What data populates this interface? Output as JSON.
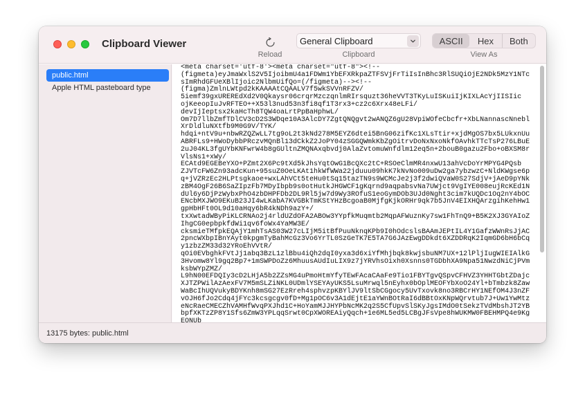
{
  "window": {
    "title": "Clipboard Viewer"
  },
  "toolbar": {
    "reload_label": "Reload",
    "clipboard_selected": "General Clipboard",
    "clipboard_label": "Clipboard",
    "view_options": [
      "ASCII",
      "Hex",
      "Both"
    ],
    "view_selected": "ASCII",
    "view_label": "View As"
  },
  "sidebar": {
    "items": [
      {
        "label": "public.html",
        "selected": true
      },
      {
        "label": "Apple HTML pasteboard type",
        "selected": false
      }
    ]
  },
  "content": {
    "lines": [
      "<meta charset='utf-8'><meta charset=\"utf-8\"><!--",
      "(figmeta)eyJmaWxlS2V5IjoibmU4a1FDWm1YbEFXRkpaZTFSVjFrTiIsInBhc3RlSUQiOjE2NDk5MzY1NTc",
      "sImRhdGFUeXBlIjoic2NlbmUifQo=(/figmeta)--><!--",
      "(figma)ZmlnLWtpd2kKAAAAtCQAALV7f5wkSVVnRFZV/",
      "5iemf39gxUREREdXd2V0Qkaysr06crqrMzczqnlmRIrsquzt36heVVT3TKyLuISKuiIjKIXLAcYjIISIic",
      "ojKeeopIuJvRFTEO++X53l3nud53n3fi8qf1T3rx3+cz2c6Xrx48eLFi/",
      "devIjIeptsx2kaHcTh8TQW4oaLrtPpBaHphwL/",
      "Om7D7llbZmfTDlCV3cD2S3WDqe10A3AlcDY7ZgtQNQgvt2wANQZ6gU28VpiWOfeCbcfr+XbLNannascNnebl",
      "XrDldluNXtfb9M0G9V/TYK/",
      "hdqi+ntV9u+nbwRZQZwLL7tg9oL2t3kNd278M5EYZ6dtei5BnG06zifKc1XLsTtir+xjdMgOS7bx5LUkxnUu",
      "ABRFLs9+HWoDybbPRczvMQnBl13dCkkZ2JoPY04zSGGQWmkKbZgOitrvDoNxNxoNkfOAvhkTTcTsP276LBuE",
      "2uJ04KL3fgUYbKNFwrW4b8gGUltnZMQNAxqbvdj0AlaZvtomuWnfdlm12eq5n+2bouB0gazu2Fbo+oBXSM8r",
      "VlsNs1+xWy/",
      "ECAtd9EGEBeYXO+PZmt2X6Pc9tXd5kJhsYqtOwG1BcQXc2tC+RSOeClmMR4nxwU13ahVcDoYrMPYG4PQsb",
      "ZJVTcFW6Zn93adcKun+95suZ0OeLKAt1hkWfWWa22jduuu09hkK7kNvNo009uDw2ga7ybzwzC+NldKWgse6p",
      "q+jVZRzEc2HLPtsgkaoe+wxLAhVCt5teHu0tSq15tazTN9s9WCMcJe2j3f2dwiQVaW0S27SdjV+jAeD9pYNk",
      "zBM4OgF26B6SaZIpzFb7MDyIbpb9s0otHutkJHGWCF1gKqrnd9aqpabsvNa7UWjct9VgIYE008eujRcKEd1N",
      "dUl6y6DjPzWybxPhO4zbDHPFDb2DL9Rl5jw7d9Wy3ROfuS1eoGymDOb3UJd0Nght3cim7kUQDc1Oq2nY4bOC",
      "ENcbMXJWO9EKuB23JI4wLKabA7KVGBkTmKStYHzBcgoaB0MjfgKjkORHr9qk7b5JnV4EIXHQArzgihKehHw1",
      "gpHbHFt0OL9d10aHqy6bR4kNDh9azY+/",
      "txXwtadWByPiKLCRNAo2j4rldUZdOFA2ABOw3YYpfkMuqmtb2MqpAFWuznKy7sw1FhTnQ9+B5K2XJ3GYAIoZ",
      "IhgCG0epbpkfdWi1qv6foWx4YaMW3E/",
      "cksmieTMfpkEQAjY1mhTsAS03W27cLIjM5itBfPuuNknqKPb9I0hOdcslsBAAmJEPtIL4Y1GafzWWnRsJjAC",
      "2pncWXbpIBnYAyt0kpgmTyBahMcGz3Vo6YrTL0SzGeTK7E5TA7G6JAzEwgDDkdt6XZDDRqK2IqmGD6bH6bCq",
      "y1zbzZM33d32YRoEhVVtR/",
      "qOi0EVbghkFVtJj1abq3BzL1zlBbu4iQh2dqI0yxa3d6xiYfMhjbqk8kwjsbuNM7UX+12lPljIugWIEIAlkG",
      "3Hvomw8Yl9gq2Bp7+1mSWPDoZz6MhuusAUdIuLIX9z7jYRVhsOixh0Xsnns0TGDbhXA9Npa51NwzdNiCjPVm",
      "ksbWYpZMZ/",
      "L9hN00EFDQIy3cD2LHjA5b2ZZsMG4uPmoHtmYfyTEwFAcaCAaFe9Tio1FBYTgvQSpvCFHVZ3YHHTGbtZDajc",
      "XJTZPWilAzAexFV7M5mSLZiNKL0UDmlYSEYAyUKS5LsuMrwql5nEyhx0bOplMEOFYbXoO24Yl+bTmbzk8Zaw",
      "WaBcIhUQVukyBDYKnh8mSG27EzRreh4sphvzpKBYlJV9ltSbCGgocy5UvTxovk8no3RBCrHY1NEfOM4J3nZF",
      "vOJH6fJo2Cdq4jFYc3kcsgcgv0fD+Mg1pOC6v3A1dEjtE1aYWnBOtRaI6dBBtOxKNpWQrvtub7J+Uw1YwMtz",
      "eNcRaeCMECZhVAMHfWvqPXJhd1C+HoYamMJJHYPbNcMK2q2S5CfUpvSlSKyJgsIMdO0tSekzTVdMbshJT2YB",
      "bpfXKTzZP8Y1Sfs6ZmW3YPLqqSrwt0CpXWOREAiyQqch+1e6ML5ed5LCBgJFsVpe8hWUKMW0FBEHMPQ4e9Kg",
      "EONUb"
    ]
  },
  "status": {
    "text": "13175 bytes: public.html"
  }
}
